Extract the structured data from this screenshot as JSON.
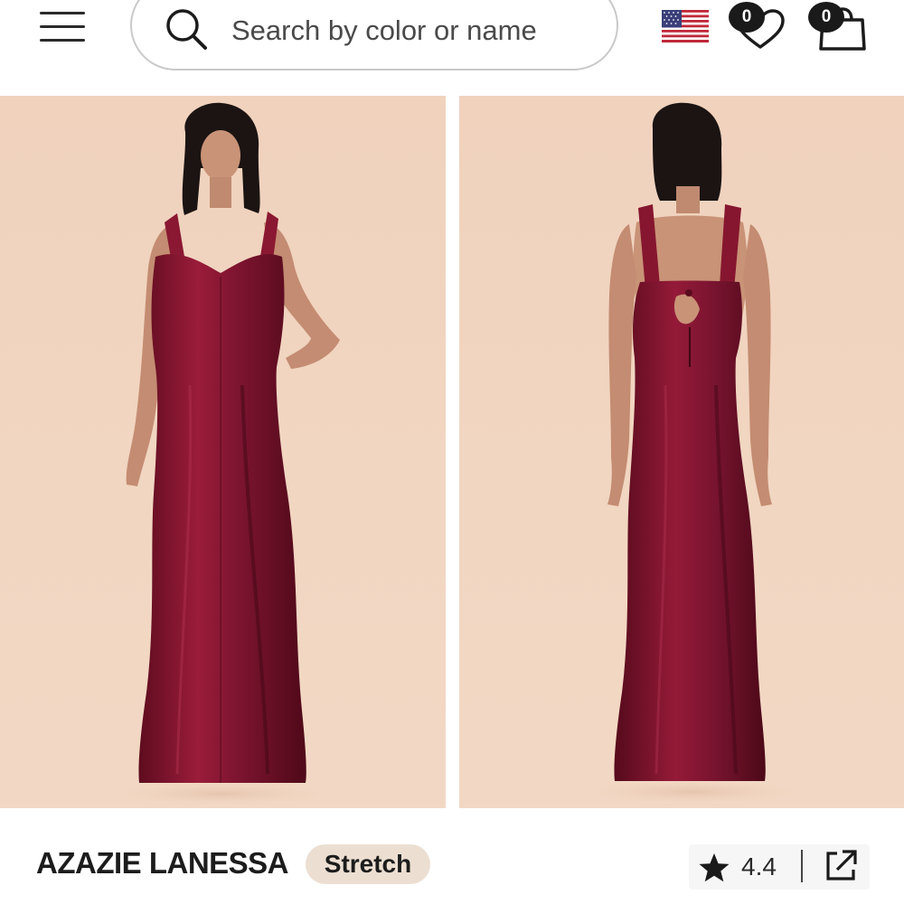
{
  "header": {
    "menu_icon": "hamburger-menu-icon",
    "search": {
      "placeholder": "Search by color or name",
      "value": "",
      "icon": "search-icon"
    },
    "region_flag": "us-flag-icon",
    "wishlist": {
      "icon": "heart-icon",
      "count": "0"
    },
    "cart": {
      "icon": "shopping-bag-icon",
      "count": "0"
    }
  },
  "gallery": {
    "images": [
      {
        "label": "front-view",
        "dress_color": "#8a1630"
      },
      {
        "label": "back-view",
        "dress_color": "#8a1630"
      }
    ],
    "background_color": "#f0d4c0"
  },
  "product": {
    "title": "AZAZIE LANESSA",
    "badge": "Stretch",
    "rating": "4.4",
    "rating_icon": "star-icon",
    "share_icon": "share-external-icon"
  }
}
